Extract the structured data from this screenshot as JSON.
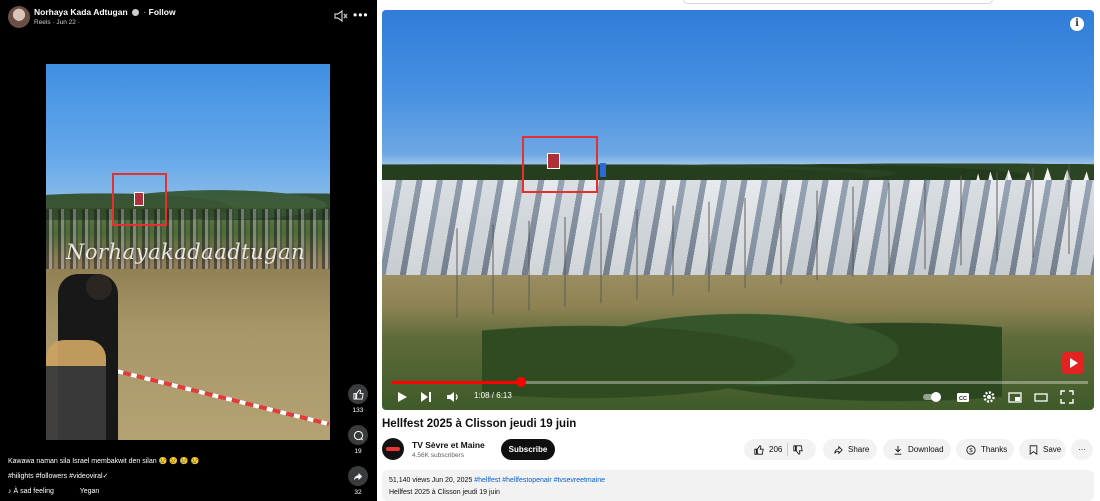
{
  "facebook": {
    "author": "Norhaya Kada Adtugan",
    "follow_label": "Follow",
    "post_meta": "Reels · Jun 22 ·",
    "video_watermark": "Norhayakadaadtugan",
    "likes_count": "133",
    "comments_count": "19",
    "shares_count": "32",
    "caption": "Kawawa naman sila Israel membakwit den silan 😢 😢 😢 😢",
    "hashtags": "#hilights #followers #videoviral✓",
    "audio_text": "À sad feeling",
    "audio_artist": "Yegan"
  },
  "youtube": {
    "video_title": "Hellfest 2025 à Clisson jeudi 19 juin",
    "current_time": "1:08 / 6:13",
    "progress_fraction": 0.185,
    "channel_name": "TV Sèvre et Maine",
    "subscribers": "4.56K subscribers",
    "subscribe_label": "Subscribe",
    "like_count": "206",
    "share_label": "Share",
    "download_label": "Download",
    "thanks_label": "Thanks",
    "save_label": "Save",
    "more_label": "···",
    "views_date": "51,140 views  Jun 20, 2025",
    "description_tags": "#hellfest #hellfestopenair #tvsevreetmaine",
    "description_text": "Hellfest 2025 à Clisson jeudi 19 juin"
  },
  "colors": {
    "highlight_box": "#e53030",
    "youtube_red": "#ff0000",
    "link_blue": "#065fd4"
  }
}
